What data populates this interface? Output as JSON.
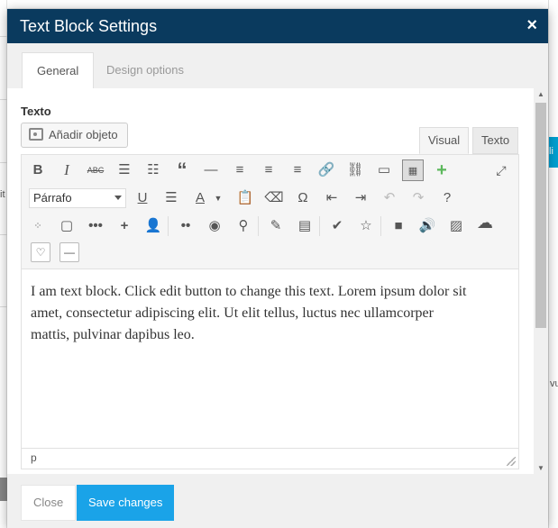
{
  "modal": {
    "title": "Text Block Settings",
    "close_glyph": "×",
    "tabs": [
      {
        "label": "General",
        "active": true
      },
      {
        "label": "Design options",
        "active": false
      }
    ]
  },
  "field": {
    "label": "Texto",
    "add_media_label": "Añadir objeto"
  },
  "editor": {
    "tabs": {
      "visual": "Visual",
      "text": "Texto"
    },
    "format_select": "Párrafo",
    "content_lines": [
      "I am text block. Click edit button to change this text. Lorem ipsum dolor sit",
      "amet, consectetur adipiscing elit. Ut elit tellus, luctus nec ullamcorper",
      "mattis, pulvinar dapibus leo."
    ],
    "status_path": "p"
  },
  "footer": {
    "close_label": "Close",
    "save_label": "Save changes"
  },
  "background": {
    "left_snippet": "it",
    "right_snippet": "vu",
    "right_tab_snippet": "li"
  },
  "colors": {
    "header_bg": "#0a3a5e",
    "save_button_bg": "#1aa3e8",
    "insert_green": "#5cb85c"
  },
  "icons": {
    "row1": [
      "bold-icon",
      "italic-icon",
      "strikethrough-icon",
      "bullet-list-icon",
      "numbered-list-icon",
      "blockquote-icon",
      "horizontal-line-icon",
      "align-left-icon",
      "align-center-icon",
      "align-right-icon",
      "link-icon",
      "unlink-icon",
      "read-more-icon",
      "toolbar-toggle-icon",
      "add-element-icon",
      "fullscreen-icon"
    ],
    "row2": [
      "underline-icon",
      "justify-icon",
      "text-color-icon",
      "paste-text-icon",
      "clear-format-icon",
      "special-char-icon",
      "outdent-icon",
      "indent-icon",
      "undo-icon",
      "redo-icon",
      "help-icon"
    ],
    "row3": [
      "grid-icon",
      "rounded-box-icon",
      "dots-icon",
      "plus-icon",
      "person-icon",
      "flickr-icon",
      "rss-icon",
      "map-pin-icon",
      "pencil-icon",
      "list-box-icon",
      "check-icon",
      "star-icon",
      "video-icon",
      "audio-icon",
      "image-icon",
      "cloud-icon"
    ],
    "row4": [
      "heart-icon",
      "divider-icon"
    ]
  }
}
